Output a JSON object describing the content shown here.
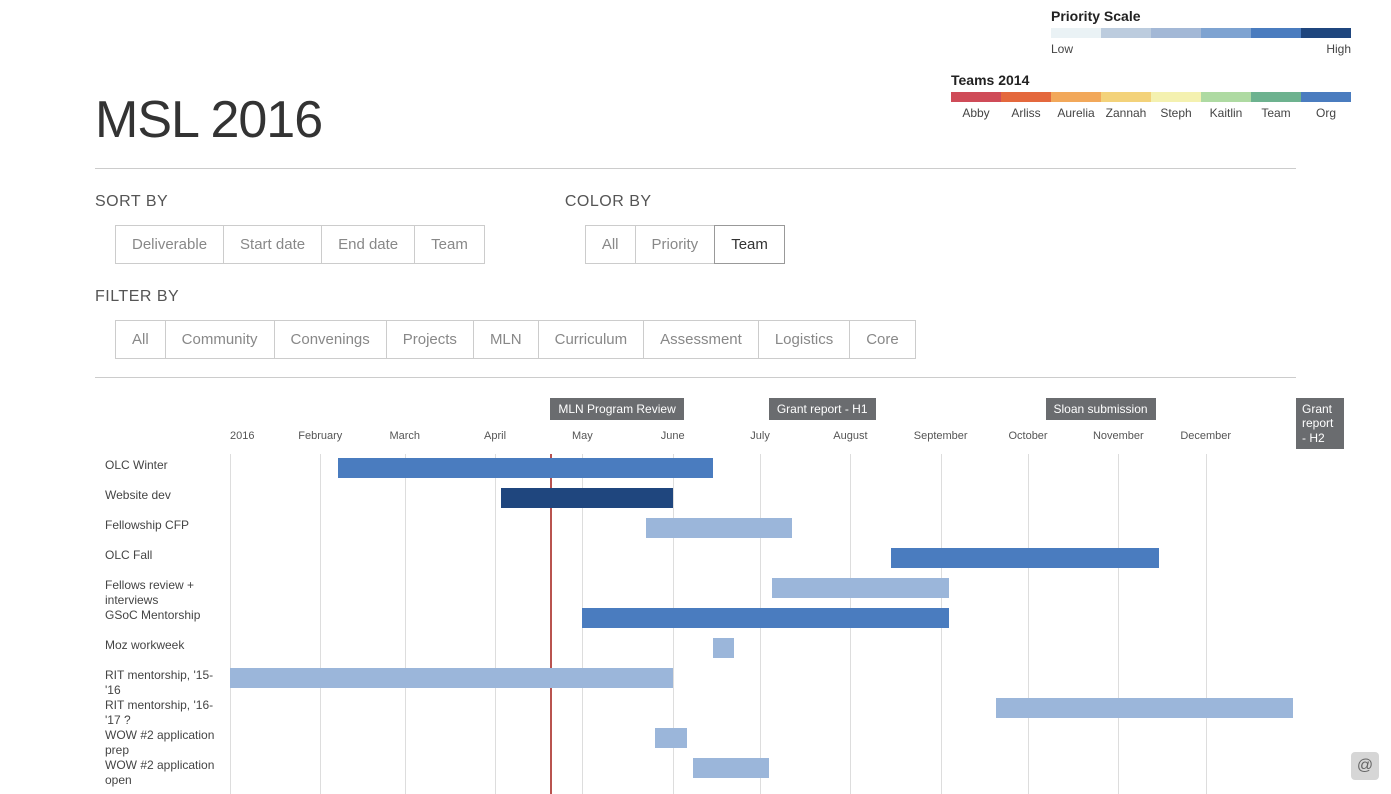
{
  "title": "MSL 2016",
  "legends": {
    "priority": {
      "title": "Priority Scale",
      "low": "Low",
      "high": "High",
      "colors": [
        "#eaf2f5",
        "#bcccde",
        "#a3b8d6",
        "#7ea3d1",
        "#4a7cbf",
        "#1f467e"
      ]
    },
    "teams": {
      "title": "Teams 2014",
      "items": [
        {
          "label": "Abby",
          "color": "#cf4b58"
        },
        {
          "label": "Arliss",
          "color": "#e4683d"
        },
        {
          "label": "Aurelia",
          "color": "#f2a85a"
        },
        {
          "label": "Zannah",
          "color": "#f3d27a"
        },
        {
          "label": "Steph",
          "color": "#f4f1b0"
        },
        {
          "label": "Kaitlin",
          "color": "#aedaa2"
        },
        {
          "label": "Team",
          "color": "#6db28f"
        },
        {
          "label": "Org",
          "color": "#4a7cbf"
        }
      ]
    }
  },
  "controls": {
    "sort_by": {
      "heading": "SORT BY",
      "options": [
        "Deliverable",
        "Start date",
        "End date",
        "Team"
      ],
      "active": null
    },
    "color_by": {
      "heading": "COLOR BY",
      "options": [
        "All",
        "Priority",
        "Team"
      ],
      "active": "Team"
    },
    "filter_by": {
      "heading": "FILTER BY",
      "options": [
        "All",
        "Community",
        "Convenings",
        "Projects",
        "MLN",
        "Curriculum",
        "Assessment",
        "Logistics",
        "Core"
      ],
      "active": null
    }
  },
  "chart_data": {
    "type": "gantt",
    "x_start": "2016-01-01",
    "x_end": "2017-01-01",
    "today": "2016-04-20",
    "months": [
      "2016",
      "February",
      "March",
      "April",
      "May",
      "June",
      "July",
      "August",
      "September",
      "October",
      "November",
      "December"
    ],
    "flags": [
      {
        "label": "MLN Program Review",
        "x": "2016-04-20"
      },
      {
        "label": "Grant report - H1",
        "x": "2016-07-04"
      },
      {
        "label": "Sloan submission",
        "x": "2016-10-07"
      },
      {
        "label": "Grant report - H2",
        "x": "2017-01-01",
        "wrap": true
      }
    ],
    "rows": [
      {
        "label": "OLC Winter",
        "start": "2016-02-07",
        "end": "2016-06-15",
        "color": "org"
      },
      {
        "label": "Website dev",
        "start": "2016-04-03",
        "end": "2016-06-01",
        "color": "dark"
      },
      {
        "label": "Fellowship CFP",
        "start": "2016-05-23",
        "end": "2016-07-12",
        "color": "mid"
      },
      {
        "label": "OLC Fall",
        "start": "2016-08-15",
        "end": "2016-11-15",
        "color": "org"
      },
      {
        "label": "Fellows review + interviews",
        "start": "2016-07-05",
        "end": "2016-09-04",
        "color": "mid"
      },
      {
        "label": "GSoC Mentorship",
        "start": "2016-05-01",
        "end": "2016-09-04",
        "color": "org"
      },
      {
        "label": "Moz workweek",
        "start": "2016-06-15",
        "end": "2016-06-22",
        "color": "mid"
      },
      {
        "label": "RIT mentorship, '15-'16",
        "start": "2016-01-01",
        "end": "2016-06-01",
        "color": "mid"
      },
      {
        "label": "RIT mentorship, '16-'17 ?",
        "start": "2016-09-20",
        "end": "2016-12-31",
        "color": "mid"
      },
      {
        "label": "WOW #2 application prep",
        "start": "2016-05-26",
        "end": "2016-06-06",
        "color": "mid"
      },
      {
        "label": "WOW #2 application open",
        "start": "2016-06-08",
        "end": "2016-07-04",
        "color": "mid"
      }
    ]
  }
}
